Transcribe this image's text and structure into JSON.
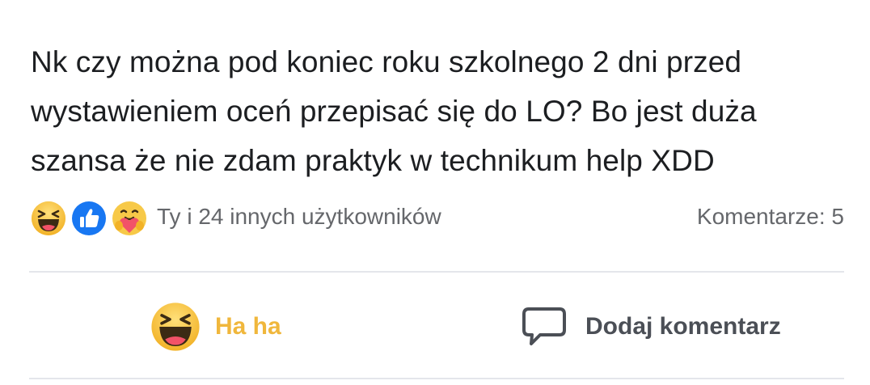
{
  "post": {
    "text_lines": [
      "Nk czy można pod koniec roku szkolnego 2 dni przed",
      "wystawieniem oceń przepisać się do LO? Bo jest duża",
      "szansa że nie zdam praktyk w technikum help XDD"
    ]
  },
  "reactions": {
    "icons": [
      "haha-icon",
      "like-icon",
      "care-icon"
    ],
    "summary": "Ty i 24 innych użytkowników",
    "comments_count": "Komentarze: 5"
  },
  "actions": {
    "reaction_label": "Ha ha",
    "comment_label": "Dodaj komentarz"
  },
  "colors": {
    "reaction_active": "#f0b73c",
    "like_blue": "#1877f2",
    "text_secondary": "#65676b",
    "divider": "#e4e6eb"
  }
}
